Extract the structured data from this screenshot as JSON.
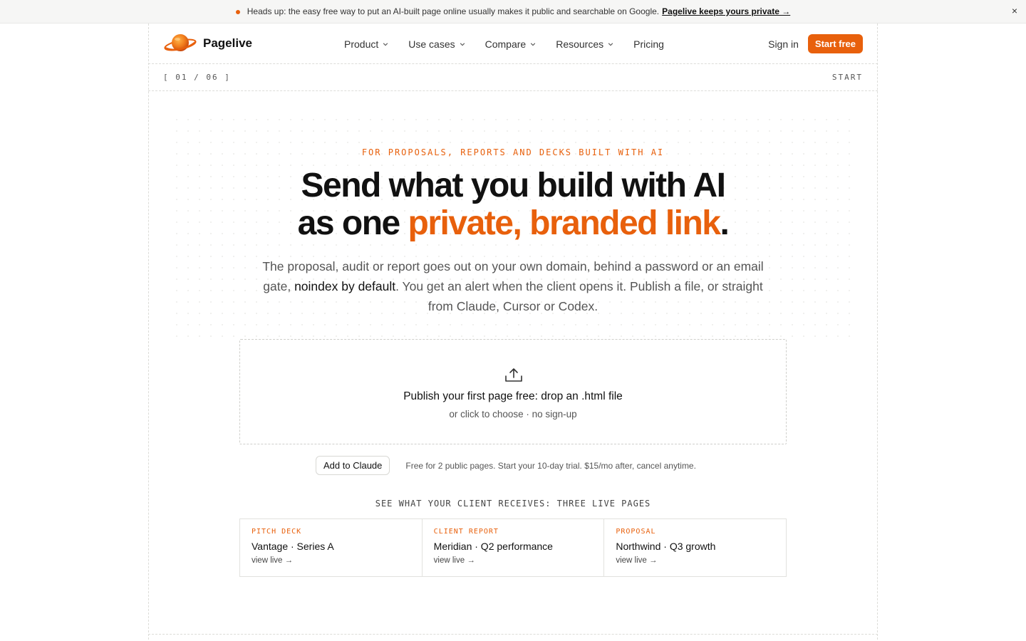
{
  "announcement": {
    "text": "Heads up: the easy free way to put an AI-built page online usually makes it public and searchable on Google.",
    "link": "Pagelive keeps yours private →",
    "close": "×"
  },
  "nav": {
    "brand": "Pagelive",
    "menu": [
      {
        "label": "Product",
        "has_dropdown": true
      },
      {
        "label": "Use cases",
        "has_dropdown": true
      },
      {
        "label": "Compare",
        "has_dropdown": true
      },
      {
        "label": "Resources",
        "has_dropdown": true
      },
      {
        "label": "Pricing",
        "has_dropdown": false
      }
    ],
    "signin": "Sign in",
    "cta": "Start free"
  },
  "stepbar": {
    "counter": "[ 01 / 06 ]",
    "section": "START"
  },
  "hero": {
    "eyebrow": "FOR PROPOSALS, REPORTS AND DECKS BUILT WITH AI",
    "headline_line1": "Send what you build with AI",
    "headline_prefix": "as one ",
    "headline_accent": "private, branded link",
    "headline_suffix": ".",
    "sub_part1": "The proposal, audit or report goes out on your own domain, behind a password or an email gate, ",
    "sub_strong": "noindex by default",
    "sub_part2": ". You get an alert when the client opens it. Publish a file, or straight from Claude, Cursor or Codex."
  },
  "dropzone": {
    "icon": "upload-icon",
    "title": "Publish your first page free: drop an .html file",
    "subtitle": "or click to choose · no sign-up"
  },
  "cta_row": {
    "button": "Add to Claude",
    "note": "Free for 2 public pages. Start your 10-day trial. $15/mo after, cancel anytime."
  },
  "showcase": {
    "label": "SEE WHAT YOUR CLIENT RECEIVES: THREE LIVE PAGES",
    "cards": [
      {
        "kicker": "PITCH DECK",
        "title": "Vantage · Series A",
        "link": "view live →"
      },
      {
        "kicker": "CLIENT REPORT",
        "title": "Meridian · Q2 performance",
        "link": "view live →"
      },
      {
        "kicker": "PROPOSAL",
        "title": "Northwind · Q3 growth",
        "link": "view live →"
      }
    ]
  },
  "colors": {
    "accent": "#e8600c",
    "text": "#111111",
    "muted": "#555555"
  }
}
